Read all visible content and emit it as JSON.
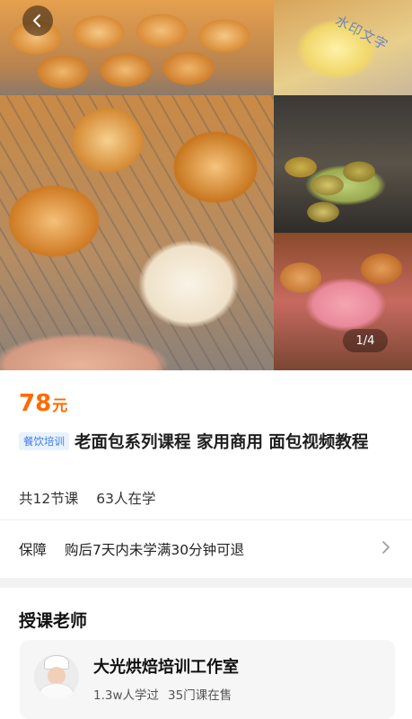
{
  "hero": {
    "watermark": "水印文字",
    "counter": "1/4"
  },
  "product": {
    "price_number": "78",
    "price_unit": "元",
    "category_tag": "餐饮培训",
    "title": "老面包系列课程 家用商用 面包视频教程",
    "lessons": "共12节课",
    "learners": "63人在学"
  },
  "guarantee": {
    "label": "保障",
    "text": "购后7天内未学满30分钟可退"
  },
  "teacher": {
    "heading": "授课老师",
    "name": "大光烘焙培训工作室",
    "learned": "1.3w人学过",
    "courses": "35门课在售"
  },
  "colors": {
    "price": "#ff6a00",
    "tag_bg": "#e9f2ff",
    "tag_text": "#3d7be0"
  },
  "icons": [
    "back-arrow-icon",
    "chevron-right-icon",
    "teacher-avatar"
  ]
}
